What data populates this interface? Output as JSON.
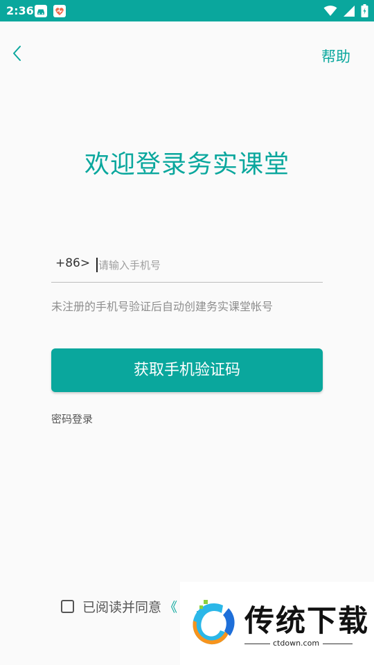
{
  "status_bar": {
    "time": "2:36",
    "background": "#0aa79d",
    "icons": [
      "car-notification-icon",
      "health-app-notification-icon",
      "wifi-icon",
      "cell-signal-icon",
      "battery-icon"
    ]
  },
  "header": {
    "back_icon": "chevron-left-icon",
    "help_label": "帮助"
  },
  "main": {
    "welcome": "欢迎登录务实课堂",
    "country_code": "+86>",
    "phone_placeholder": "请输入手机号",
    "phone_value": "",
    "hint": "未注册的手机号验证后自动创建务实课堂帐号",
    "submit_label": "获取手机验证码",
    "password_login": "密码登录"
  },
  "agreement": {
    "checked": false,
    "text": "已阅读并同意",
    "link": "《"
  },
  "watermark": {
    "title": "传统下载",
    "domain": "ctdown.com"
  },
  "colors": {
    "accent": "#0aa79d",
    "background": "#fafafa"
  }
}
